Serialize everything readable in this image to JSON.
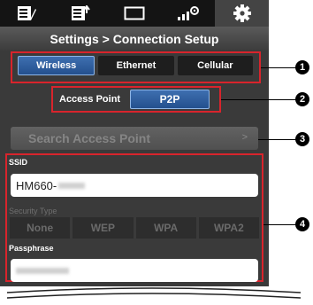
{
  "header": {
    "tabs": [
      {
        "icon": "edit-list-icon",
        "active": false
      },
      {
        "icon": "clip-upload-icon",
        "active": false
      },
      {
        "icon": "monitor-icon",
        "active": false
      },
      {
        "icon": "camera-settings-icon",
        "active": false
      },
      {
        "icon": "gear-icon",
        "active": true
      }
    ],
    "breadcrumb": "Settings > Connection Setup"
  },
  "connection_type": {
    "options": [
      "Wireless",
      "Ethernet",
      "Cellular"
    ],
    "selected": "Wireless"
  },
  "wireless_mode": {
    "label": "Access Point",
    "button": "P2P"
  },
  "search": {
    "label": "Search Access Point",
    "chevron": ">",
    "enabled": false
  },
  "ssid": {
    "label": "SSID",
    "value": "HM660-"
  },
  "security_type": {
    "label": "Security Type",
    "options": [
      "None",
      "WEP",
      "WPA",
      "WPA2"
    ],
    "enabled": false
  },
  "passphrase": {
    "label": "Passphrase"
  },
  "callouts": [
    "1",
    "2",
    "3",
    "4"
  ],
  "colors": {
    "highlight_box": "#d8242c",
    "selected_button": "#2c5c9e",
    "panel_bg": "#3a3a3a",
    "topbar_bg": "#141414"
  }
}
